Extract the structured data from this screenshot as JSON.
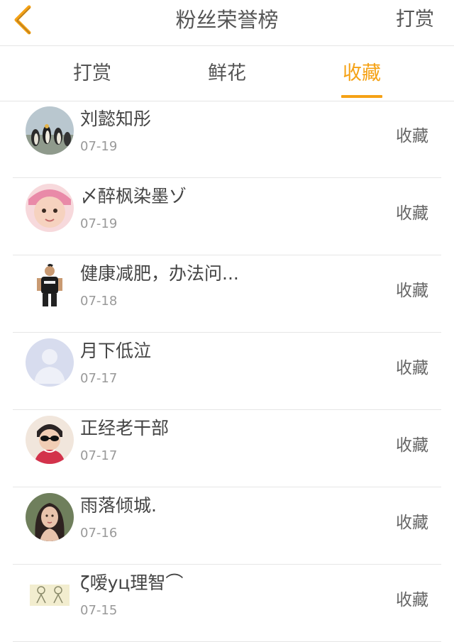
{
  "header": {
    "title": "粉丝荣誉榜",
    "action_label": "打赏",
    "back_icon": "chevron-left-icon",
    "accent_color": "#f5a216"
  },
  "tabs": [
    {
      "label": "打赏",
      "active": false
    },
    {
      "label": "鲜花",
      "active": false
    },
    {
      "label": "收藏",
      "active": true
    }
  ],
  "list": {
    "items": [
      {
        "name": "刘懿知彤",
        "date": "07-19",
        "action": "收藏",
        "avatar": "penguins-avatar"
      },
      {
        "name": "〆醉枫染墨ゾ",
        "date": "07-19",
        "action": "收藏",
        "avatar": "baby-avatar"
      },
      {
        "name": "健康减肥，办法问...",
        "date": "07-18",
        "action": "收藏",
        "avatar": "man-standing-avatar"
      },
      {
        "name": "月下低泣",
        "date": "07-17",
        "action": "收藏",
        "avatar": "default-user-avatar"
      },
      {
        "name": "正经老干部",
        "date": "07-17",
        "action": "收藏",
        "avatar": "sunglasses-avatar"
      },
      {
        "name": "雨落倾城.",
        "date": "07-16",
        "action": "收藏",
        "avatar": "woman-avatar"
      },
      {
        "name": "ζ嗳yц理智⌒",
        "date": "07-15",
        "action": "收藏",
        "avatar": "sketch-avatar"
      }
    ]
  }
}
